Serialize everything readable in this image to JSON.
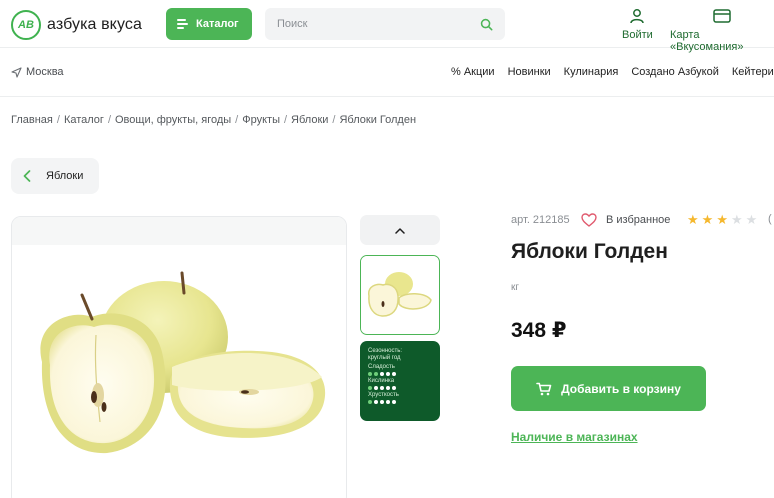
{
  "header": {
    "logo_text": "азбука вкуса",
    "logo_mark": "АВ",
    "catalog_label": "Каталог",
    "search_placeholder": "Поиск",
    "login_label": "Войти",
    "card_label": "Карта «Вкусомания»"
  },
  "subnav": {
    "city": "Москва",
    "links": [
      "% Акции",
      "Новинки",
      "Кулинария",
      "Создано Азбукой",
      "Кейтеринг"
    ]
  },
  "breadcrumbs": [
    "Главная",
    "Каталог",
    "Овощи, фрукты, ягоды",
    "Фрукты",
    "Яблоки",
    "Яблоки Голден"
  ],
  "back_label": "Яблоки",
  "product": {
    "article": "арт. 212185",
    "favorite_label": "В избранное",
    "rating": 3,
    "rating_max": 5,
    "rating_count": "(",
    "title": "Яблоки Голден",
    "unit": "кг",
    "price": "348 ₽",
    "add_to_cart_label": "Добавить в корзину",
    "availability_label": "Наличие в магазинах"
  },
  "info_card": {
    "season_label": "Сезонность:",
    "season_value": "круглый год",
    "sweetness_label": "Сладость",
    "sweetness": 2,
    "acidity_label": "Кислинка",
    "acidity": 1,
    "crunch_label": "Хрусткость",
    "crunch": 1
  },
  "colors": {
    "brand_green": "#4cb556",
    "dark_green": "#0e5a2a",
    "star": "#f5b82e"
  }
}
